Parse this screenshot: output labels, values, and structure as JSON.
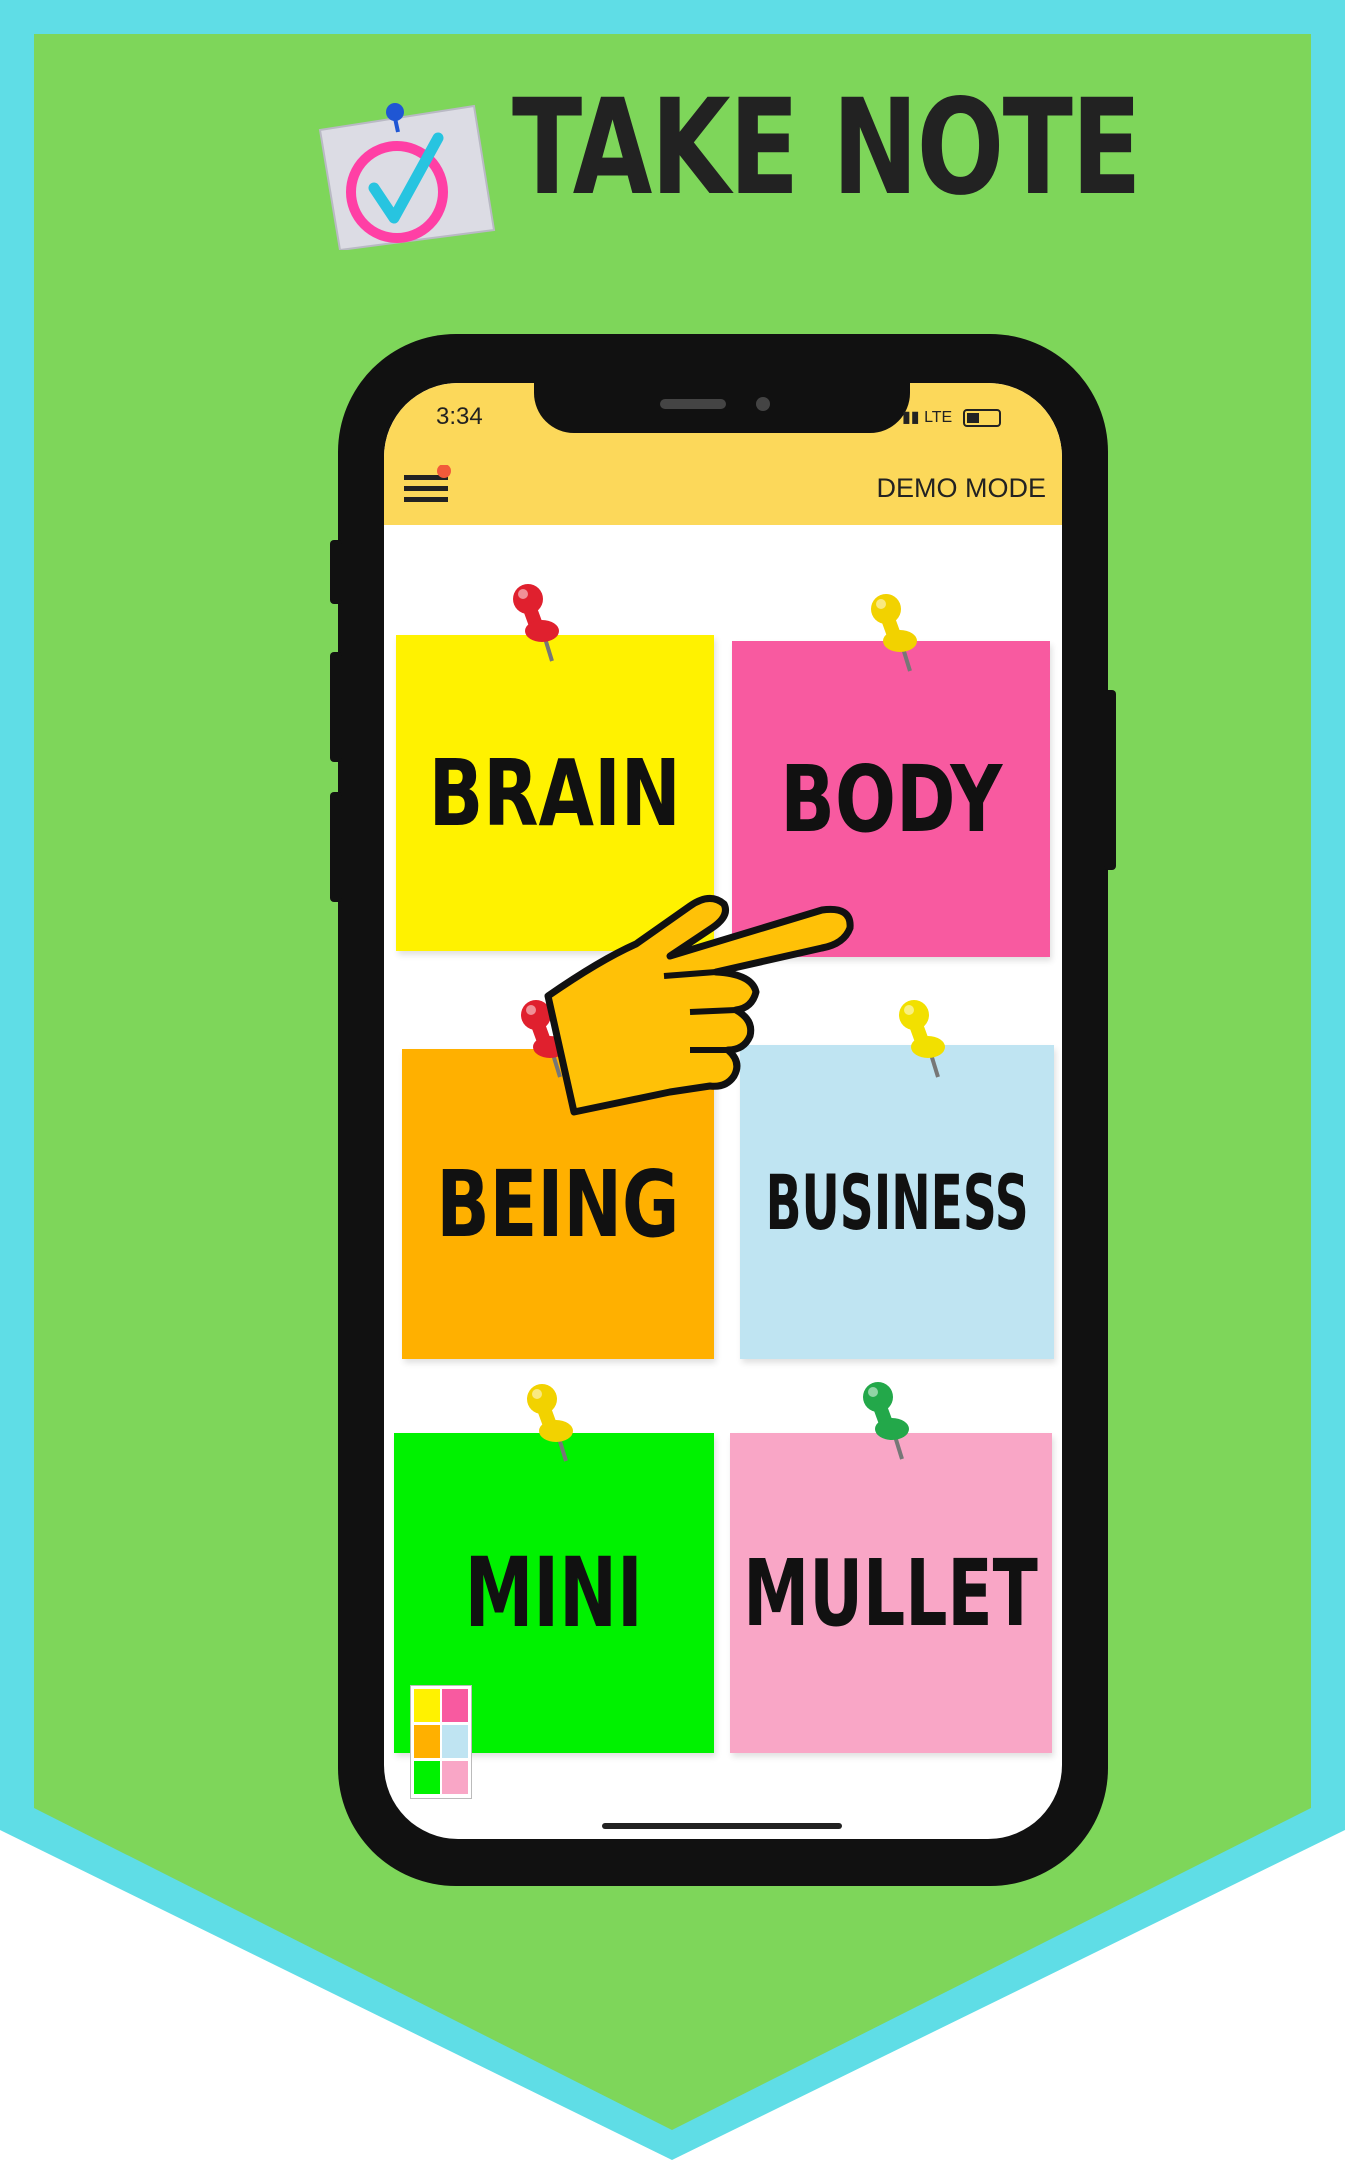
{
  "banner": {
    "title": "TAKE NOTE",
    "colors": {
      "outer": "#5fdde6",
      "inner": "#7ed65a"
    }
  },
  "phone": {
    "status_time": "3:34",
    "status_right": "LTE",
    "demo_label": "DEMO MODE",
    "menu_icon": "hamburger-menu-icon"
  },
  "notes": [
    {
      "label": "BRAIN",
      "color": "#fff200",
      "pin": "#e0202e"
    },
    {
      "label": "BODY",
      "color": "#f85aa0",
      "pin": "#f2d200"
    },
    {
      "label": "BEING",
      "color": "#ffb000",
      "pin": "#e0202e"
    },
    {
      "label": "BUSINESS",
      "color": "#bfe4f2",
      "pin": "#f2e000"
    },
    {
      "label": "MINI",
      "color": "#00f200",
      "pin": "#f2d200"
    },
    {
      "label": "MULLET",
      "color": "#f9a6c6",
      "pin": "#23a84a"
    }
  ],
  "hand_icon": "pointing-hand-icon"
}
